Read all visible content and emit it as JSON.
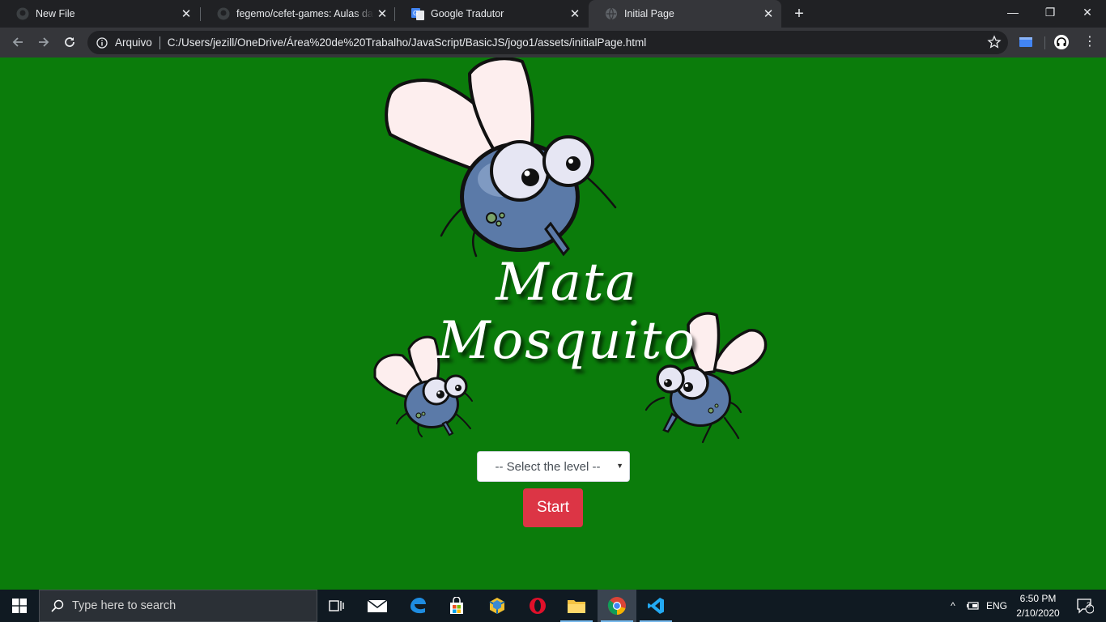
{
  "browser": {
    "tabs": [
      {
        "title": "New File",
        "favicon": "github-icon",
        "active": false
      },
      {
        "title": "fegemo/cefet-games: Aulas da disciplina",
        "favicon": "github-icon",
        "active": false
      },
      {
        "title": "Google Tradutor",
        "favicon": "google-translate-icon",
        "active": false
      },
      {
        "title": "Initial Page",
        "favicon": "globe-icon",
        "active": true
      }
    ],
    "window_controls": {
      "minimize": "—",
      "restore": "❐",
      "close": "✕"
    },
    "omnibox": {
      "scheme_label": "Arquivo",
      "url": "C:/Users/jezill/OneDrive/Área%20de%20Trabalho/JavaScript/BasicJS/jogo1/assets/initialPage.html"
    }
  },
  "page": {
    "background": "#0b7c0b",
    "title_line1": "Mata",
    "title_line2": "Mosquito",
    "level_select": {
      "placeholder": "-- Select the level --"
    },
    "start_button": {
      "label": "Start",
      "color": "#dc3545"
    }
  },
  "taskbar": {
    "search_placeholder": "Type here to search",
    "language": "ENG",
    "time": "6:50 PM",
    "date": "2/10/2020",
    "notification_count": "3"
  }
}
